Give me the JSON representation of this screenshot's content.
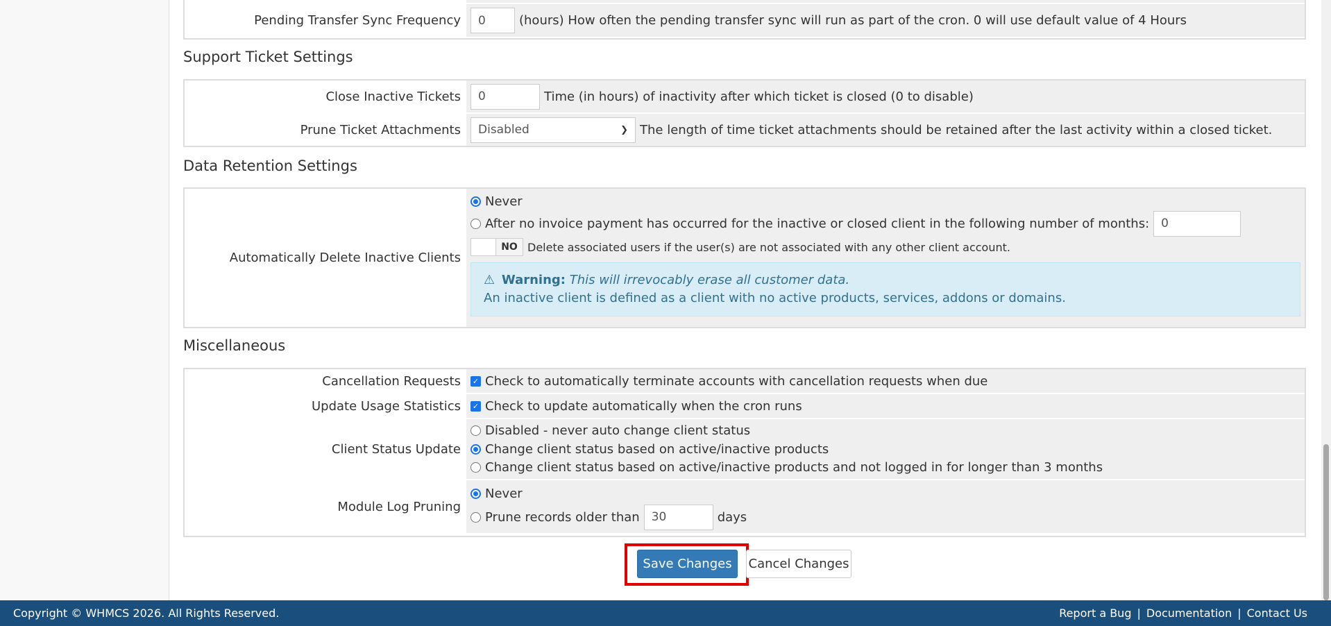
{
  "pending_transfer": {
    "label": "Pending Transfer Sync Frequency",
    "value": "0",
    "help": "(hours) How often the pending transfer sync will run as part of the cron. 0 will use default value of 4 Hours"
  },
  "support_ticket": {
    "title": "Support Ticket Settings",
    "close_inactive": {
      "label": "Close Inactive Tickets",
      "value": "0",
      "help": "Time (in hours) of inactivity after which ticket is closed (0 to disable)"
    },
    "prune_attachments": {
      "label": "Prune Ticket Attachments",
      "selected": "Disabled",
      "help": "The length of time ticket attachments should be retained after the last activity within a closed ticket."
    }
  },
  "data_retention": {
    "title": "Data Retention Settings",
    "label": "Automatically Delete Inactive Clients",
    "option_never": "Never",
    "option_after": "After no invoice payment has occurred for the inactive or closed client in the following number of months:",
    "months_value": "0",
    "toggle_state": "NO",
    "toggle_help": "Delete associated users if the user(s) are not associated with any other client account.",
    "warning_label": "Warning:",
    "warning_italic": "This will irrevocably erase all customer data.",
    "warning_text": "An inactive client is defined as a client with no active products, services, addons or domains."
  },
  "misc": {
    "title": "Miscellaneous",
    "cancellation": {
      "label": "Cancellation Requests",
      "help": "Check to automatically terminate accounts with cancellation requests when due"
    },
    "usage_stats": {
      "label": "Update Usage Statistics",
      "help": "Check to update automatically when the cron runs"
    },
    "client_status": {
      "label": "Client Status Update",
      "options": [
        "Disabled - never auto change client status",
        "Change client status based on active/inactive products",
        "Change client status based on active/inactive products and not logged in for longer than 3 months"
      ]
    },
    "module_log": {
      "label": "Module Log Pruning",
      "option_never": "Never",
      "option_prune": "Prune records older than",
      "days_value": "30",
      "days_unit": "days"
    }
  },
  "buttons": {
    "save": "Save Changes",
    "cancel": "Cancel Changes"
  },
  "footer": {
    "copyright": "Copyright © WHMCS 2026. All Rights Reserved.",
    "links": [
      "Report a Bug",
      "Documentation",
      "Contact Us"
    ],
    "separator": "|"
  }
}
